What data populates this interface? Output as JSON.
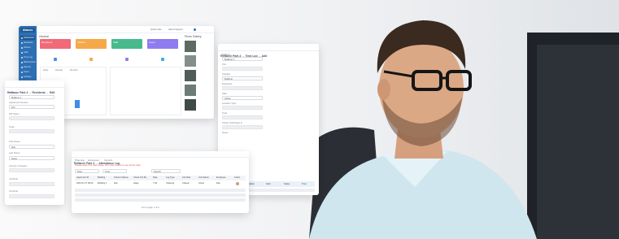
{
  "dashboard": {
    "logo": "Abacus",
    "sidebar": [
      "Dashboard",
      "Residents",
      "Visitors",
      "Staff",
      "Time Log",
      "Maintenance",
      "Reports",
      "Users",
      "Settings"
    ],
    "topbar": [
      "Dashboard",
      "Quick Links",
      "Help & Support",
      "Profile"
    ],
    "section_title": "General",
    "photos_title": "Photo Gallery",
    "stats": [
      {
        "label": "Residents",
        "color": "#f06a78"
      },
      {
        "label": "Visitors",
        "color": "#f5a94a"
      },
      {
        "label": "Staff",
        "color": "#48b98c"
      },
      {
        "label": "Users",
        "color": "#8f7cf0"
      }
    ],
    "stat_icon_colors": [
      "#4a8fe0",
      "#f5a94a",
      "#8f7cf0",
      "#3cb0d6"
    ],
    "chart_labels": [
      "Daily",
      "Weekly",
      "Monthly"
    ]
  },
  "residents": {
    "title": "Reflance Park 4 → Residents → Edit",
    "fields": [
      "Building",
      "Apartment Number",
      "NIT Name",
      "Code",
      "First Name",
      "Last Name",
      "Country of Region",
      "Job Role",
      "Job Role"
    ],
    "values": [
      "Building 1",
      "101",
      "",
      "",
      "Dan",
      "Gaga",
      "",
      "",
      ""
    ]
  },
  "timelog": {
    "title": "Reflance Park 4 → Time Log → Add",
    "fields": [
      "Building",
      "Unit",
      "Supplier",
      "Employee",
      "Start",
      "Location Type",
      "Total",
      "Check Out/Check In",
      "Notes"
    ],
    "values": [
      "Building 1",
      "",
      "Building",
      "",
      "Active",
      "",
      "",
      "",
      ""
    ],
    "columns": [
      "Building",
      "Location",
      "Start",
      "Status",
      "Time"
    ]
  },
  "attendance": {
    "title": "Reflance Park 4 → Attendance Log",
    "tabs": [
      "Time Log",
      "Employees",
      "Vendors"
    ],
    "note": "Please select the date range, then click search to see all the data",
    "filters": [
      "Date",
      "Time",
      "Search"
    ],
    "columns": [
      "Apartment ID",
      "Building",
      "Check in/Name",
      "Check Out By",
      "Date",
      "Log Type",
      "Job Role",
      "Unit Status",
      "Employee",
      "Action"
    ],
    "rows": [
      [
        "2021-07-27 08:22",
        "Building 1",
        "Dan",
        "Gaga",
        "7:30",
        "Cleaning",
        "Cleaner",
        "Active",
        "Dan",
        ""
      ]
    ],
    "pager": "Go to page 1 of 5"
  }
}
